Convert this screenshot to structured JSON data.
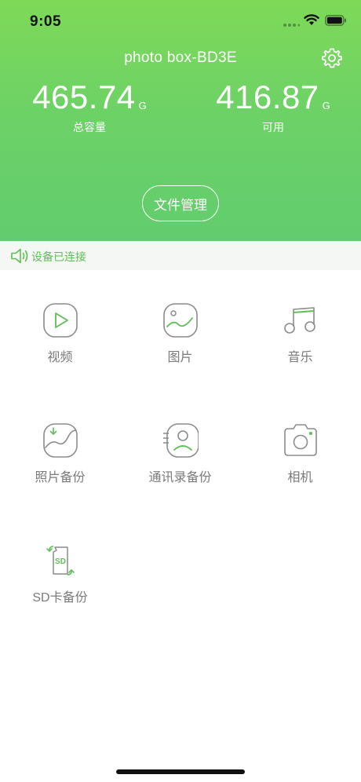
{
  "status": {
    "time": "9:05"
  },
  "header": {
    "device_name": "photo box-BD3E",
    "total": {
      "value": "465.74",
      "unit": "G",
      "label": "总容量"
    },
    "available": {
      "value": "416.87",
      "unit": "G",
      "label": "可用"
    },
    "file_manage_label": "文件管理"
  },
  "connection": {
    "status_text": "设备已连接"
  },
  "grid": {
    "items": [
      {
        "label": "视频",
        "icon": "video-play-icon"
      },
      {
        "label": "图片",
        "icon": "picture-icon"
      },
      {
        "label": "音乐",
        "icon": "music-note-icon"
      },
      {
        "label": "照片备份",
        "icon": "photo-backup-icon"
      },
      {
        "label": "通讯录备份",
        "icon": "contacts-backup-icon"
      },
      {
        "label": "相机",
        "icon": "camera-icon"
      },
      {
        "label": "SD卡备份",
        "icon": "sd-card-backup-icon"
      }
    ]
  },
  "colors": {
    "header_green": "#6dd266",
    "accent_green": "#5fbf57",
    "label_gray": "#7a7a7a"
  }
}
